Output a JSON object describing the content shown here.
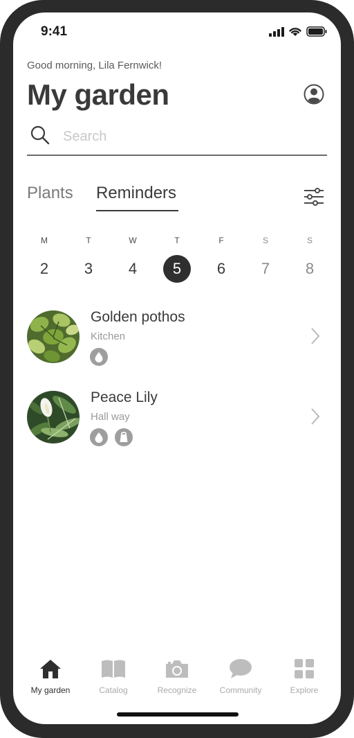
{
  "status_bar": {
    "time": "9:41"
  },
  "header": {
    "greeting": "Good morning, Lila Fernwick!",
    "title": "My garden",
    "profile_icon": "user-circle-icon"
  },
  "search": {
    "placeholder": "Search",
    "value": ""
  },
  "tabs": [
    {
      "label": "Plants",
      "active": false
    },
    {
      "label": "Reminders",
      "active": true
    }
  ],
  "week": [
    {
      "letter": "M",
      "number": "2"
    },
    {
      "letter": "T",
      "number": "3"
    },
    {
      "letter": "W",
      "number": "4"
    },
    {
      "letter": "T",
      "number": "5",
      "selected": true
    },
    {
      "letter": "F",
      "number": "6"
    },
    {
      "letter": "S",
      "number": "7"
    },
    {
      "letter": "S",
      "number": "8"
    }
  ],
  "plants": [
    {
      "name": "Golden pothos",
      "room": "Kitchen",
      "care": [
        "water-drop-icon"
      ]
    },
    {
      "name": "Peace Lily",
      "room": "Hall way",
      "care": [
        "water-drop-icon",
        "fertilizer-bag-icon"
      ]
    }
  ],
  "tab_bar": [
    {
      "label": "My garden",
      "icon": "home-icon",
      "active": true
    },
    {
      "label": "Catalog",
      "icon": "book-icon",
      "active": false
    },
    {
      "label": "Recognize",
      "icon": "camera-icon",
      "active": false
    },
    {
      "label": "Community",
      "icon": "speech-bubble-icon",
      "active": false
    },
    {
      "label": "Explore",
      "icon": "grid-icon",
      "active": false
    }
  ],
  "colors": {
    "frame": "#2b2b2b",
    "text": "#3a3a3a",
    "selected_day": "#2f2f2f",
    "care_icon": "#9e9e9e",
    "inactive": "#aaaaaa"
  }
}
